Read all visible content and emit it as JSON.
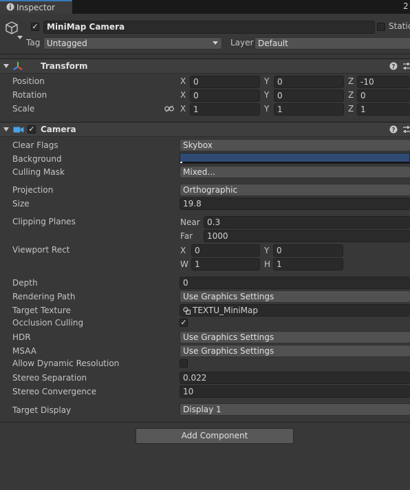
{
  "window": {
    "tab_label": "Inspector",
    "tab_icon": "info-icon",
    "tab_extra": "2"
  },
  "header": {
    "active": true,
    "object_name": "MiniMap Camera",
    "static_label": "Static",
    "tag_label": "Tag",
    "tag_value": "Untagged",
    "layer_label": "Layer",
    "layer_value": "Default"
  },
  "transform": {
    "title": "Transform",
    "position": {
      "label": "Position",
      "x": "0",
      "y": "0",
      "z": "-10"
    },
    "rotation": {
      "label": "Rotation",
      "x": "0",
      "y": "0",
      "z": "0"
    },
    "scale": {
      "label": "Scale",
      "x": "1",
      "y": "1",
      "z": "1"
    },
    "axis_x": "X",
    "axis_y": "Y",
    "axis_z": "Z"
  },
  "camera": {
    "title": "Camera",
    "enabled": true,
    "background_color": "#2f4a73",
    "fields": {
      "clear_flags": {
        "label": "Clear Flags",
        "value": "Skybox"
      },
      "background": {
        "label": "Background"
      },
      "culling_mask": {
        "label": "Culling Mask",
        "value": "Mixed..."
      },
      "projection": {
        "label": "Projection",
        "value": "Orthographic"
      },
      "size": {
        "label": "Size",
        "value": "19.8"
      },
      "clipping": {
        "label": "Clipping Planes",
        "near_label": "Near",
        "near": "0.3",
        "far_label": "Far",
        "far": "1000"
      },
      "viewport": {
        "label": "Viewport Rect",
        "x_label": "X",
        "x": "0",
        "y_label": "Y",
        "y": "0",
        "w_label": "W",
        "w": "1",
        "h_label": "H",
        "h": "1"
      },
      "depth": {
        "label": "Depth",
        "value": "0"
      },
      "rendering_path": {
        "label": "Rendering Path",
        "value": "Use Graphics Settings"
      },
      "target_texture": {
        "label": "Target Texture",
        "value": "TEXTU_MiniMap"
      },
      "occlusion_culling": {
        "label": "Occlusion Culling",
        "checked": true
      },
      "hdr": {
        "label": "HDR",
        "value": "Use Graphics Settings"
      },
      "msaa": {
        "label": "MSAA",
        "value": "Use Graphics Settings"
      },
      "dynamic_resolution": {
        "label": "Allow Dynamic Resolution",
        "checked": false
      },
      "stereo_separation": {
        "label": "Stereo Separation",
        "value": "0.022"
      },
      "stereo_convergence": {
        "label": "Stereo Convergence",
        "value": "10"
      },
      "target_display": {
        "label": "Target Display",
        "value": "Display 1"
      }
    }
  },
  "add_component_label": "Add Component",
  "checkmark": "✓"
}
